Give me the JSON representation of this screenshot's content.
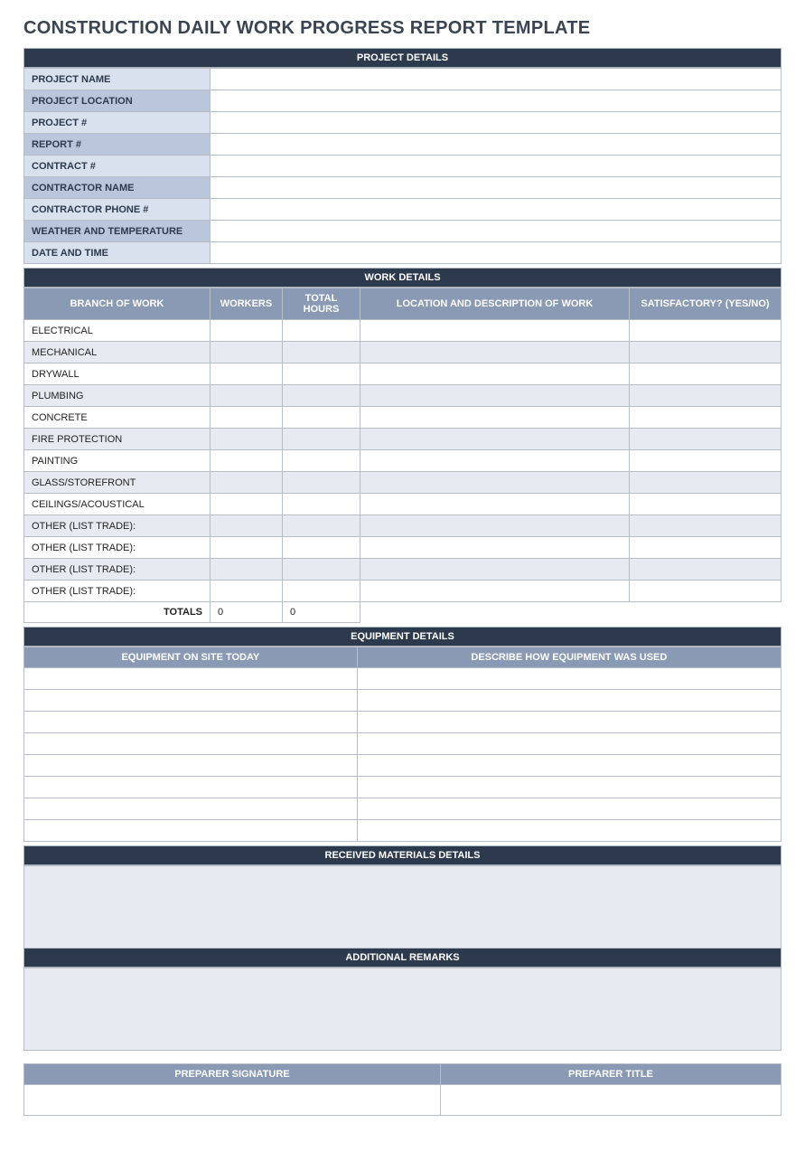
{
  "title": "CONSTRUCTION DAILY WORK PROGRESS REPORT TEMPLATE",
  "project": {
    "header": "PROJECT DETAILS",
    "rows": [
      {
        "label": "PROJECT NAME",
        "value": "",
        "shade": "bg-l1"
      },
      {
        "label": "PROJECT LOCATION",
        "value": "",
        "shade": "bg-l2"
      },
      {
        "label": "PROJECT #",
        "value": "",
        "shade": "bg-l1"
      },
      {
        "label": "REPORT #",
        "value": "",
        "shade": "bg-l2"
      },
      {
        "label": "CONTRACT #",
        "value": "",
        "shade": "bg-l1"
      },
      {
        "label": "CONTRACTOR NAME",
        "value": "",
        "shade": "bg-l2"
      },
      {
        "label": "CONTRACTOR PHONE #",
        "value": "",
        "shade": "bg-l1"
      },
      {
        "label": "WEATHER AND TEMPERATURE",
        "value": "",
        "shade": "bg-l2"
      },
      {
        "label": "DATE AND TIME",
        "value": "",
        "shade": "bg-l1"
      }
    ]
  },
  "work": {
    "header": "WORK DETAILS",
    "columns": [
      "BRANCH OF WORK",
      "WORKERS",
      "TOTAL HOURS",
      "LOCATION AND DESCRIPTION OF WORK",
      "SATISFACTORY? (YES/NO)"
    ],
    "rows": [
      {
        "branch": "ELECTRICAL",
        "workers": "",
        "hours": "",
        "loc": "",
        "sat": ""
      },
      {
        "branch": "MECHANICAL",
        "workers": "",
        "hours": "",
        "loc": "",
        "sat": ""
      },
      {
        "branch": "DRYWALL",
        "workers": "",
        "hours": "",
        "loc": "",
        "sat": ""
      },
      {
        "branch": "PLUMBING",
        "workers": "",
        "hours": "",
        "loc": "",
        "sat": ""
      },
      {
        "branch": "CONCRETE",
        "workers": "",
        "hours": "",
        "loc": "",
        "sat": ""
      },
      {
        "branch": "FIRE PROTECTION",
        "workers": "",
        "hours": "",
        "loc": "",
        "sat": ""
      },
      {
        "branch": "PAINTING",
        "workers": "",
        "hours": "",
        "loc": "",
        "sat": ""
      },
      {
        "branch": "GLASS/STOREFRONT",
        "workers": "",
        "hours": "",
        "loc": "",
        "sat": ""
      },
      {
        "branch": "CEILINGS/ACOUSTICAL",
        "workers": "",
        "hours": "",
        "loc": "",
        "sat": ""
      },
      {
        "branch": "OTHER (LIST TRADE):",
        "workers": "",
        "hours": "",
        "loc": "",
        "sat": ""
      },
      {
        "branch": "OTHER (LIST TRADE):",
        "workers": "",
        "hours": "",
        "loc": "",
        "sat": ""
      },
      {
        "branch": "OTHER (LIST TRADE):",
        "workers": "",
        "hours": "",
        "loc": "",
        "sat": ""
      },
      {
        "branch": "OTHER (LIST TRADE):",
        "workers": "",
        "hours": "",
        "loc": "",
        "sat": ""
      }
    ],
    "totals_label": "TOTALS",
    "totals": {
      "workers": "0",
      "hours": "0"
    }
  },
  "equipment": {
    "header": "EQUIPMENT DETAILS",
    "columns": [
      "EQUIPMENT ON SITE TODAY",
      "DESCRIBE HOW EQUIPMENT WAS USED"
    ],
    "row_count": 8
  },
  "materials": {
    "header": "RECEIVED MATERIALS DETAILS",
    "value": ""
  },
  "remarks": {
    "header": "ADDITIONAL REMARKS",
    "value": ""
  },
  "signature": {
    "columns": [
      "PREPARER SIGNATURE",
      "PREPARER TITLE"
    ],
    "sig": "",
    "title": ""
  }
}
